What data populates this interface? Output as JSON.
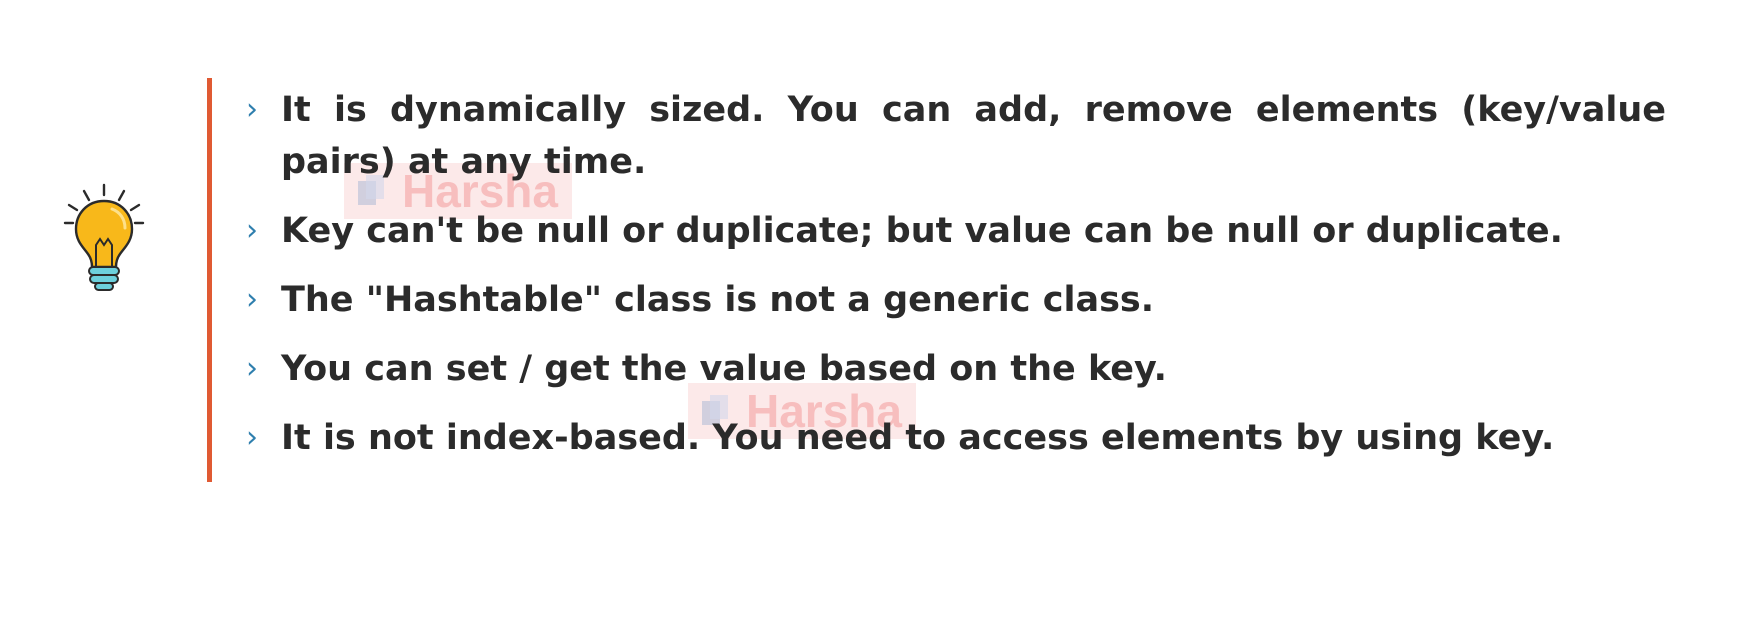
{
  "slide": {
    "icon": "lightbulb-icon",
    "accent_color": "#e05a33",
    "bullet_color": "#2f7fae",
    "bullet_glyph": "›",
    "bullets": [
      "It is dynamically sized. You can add, remove elements (key/value pairs) at any time.",
      "Key can't be null or duplicate; but value can be null or duplicate.",
      "The \"Hashtable\" class is not a generic class.",
      "You can set / get the value based on the key.",
      "It is not index-based. You need to access elements by using key."
    ]
  },
  "watermark": {
    "text": "Harsha"
  }
}
